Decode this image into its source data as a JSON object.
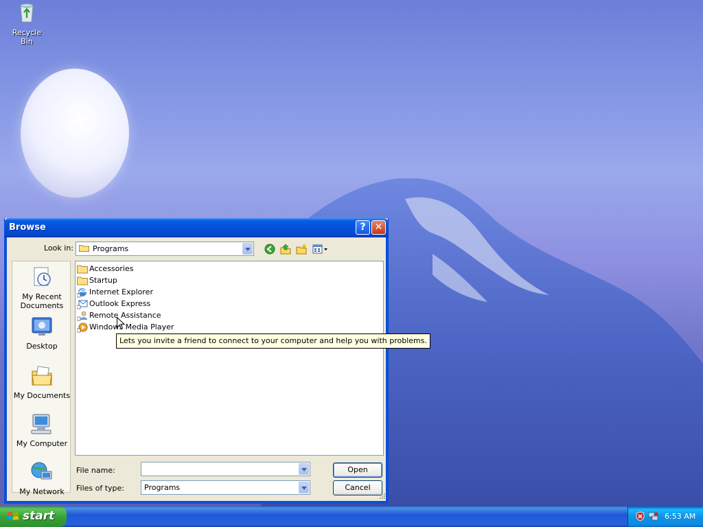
{
  "desktop": {
    "icons": [
      {
        "label": "Recycle Bin",
        "icon": "recycle-bin-icon"
      }
    ]
  },
  "dialog": {
    "title": "Browse",
    "look_in_label": "Look in:",
    "look_in_value": "Programs",
    "toolbar_icons": [
      "back-icon",
      "up-folder-icon",
      "new-folder-icon",
      "view-menu-icon"
    ],
    "places": [
      {
        "label_line1": "My Recent",
        "label_line2": "Documents",
        "icon": "recent-documents-icon"
      },
      {
        "label_line1": "Desktop",
        "label_line2": "",
        "icon": "desktop-icon"
      },
      {
        "label_line1": "My Documents",
        "label_line2": "",
        "icon": "my-documents-icon"
      },
      {
        "label_line1": "My Computer",
        "label_line2": "",
        "icon": "my-computer-icon"
      },
      {
        "label_line1": "My Network",
        "label_line2": "",
        "icon": "my-network-icon"
      }
    ],
    "files": [
      {
        "name": "Accessories",
        "icon": "folder-icon"
      },
      {
        "name": "Startup",
        "icon": "folder-icon"
      },
      {
        "name": "Internet Explorer",
        "icon": "internet-explorer-icon"
      },
      {
        "name": "Outlook Express",
        "icon": "outlook-express-icon"
      },
      {
        "name": "Remote Assistance",
        "icon": "remote-assistance-icon"
      },
      {
        "name": "Windows Media Player",
        "icon": "media-player-icon"
      }
    ],
    "tooltip": "Lets you invite a friend to connect to your computer and help you with problems.",
    "file_name_label": "File name:",
    "file_name_value": "",
    "files_of_type_label": "Files of type:",
    "files_of_type_value": "Programs",
    "open_label": "Open",
    "cancel_label": "Cancel",
    "help_label": "?",
    "close_label": "✕"
  },
  "taskbar": {
    "start_label": "start",
    "clock": "6:53 AM",
    "tray_icons": [
      "security-alert-icon",
      "network-icon"
    ]
  }
}
